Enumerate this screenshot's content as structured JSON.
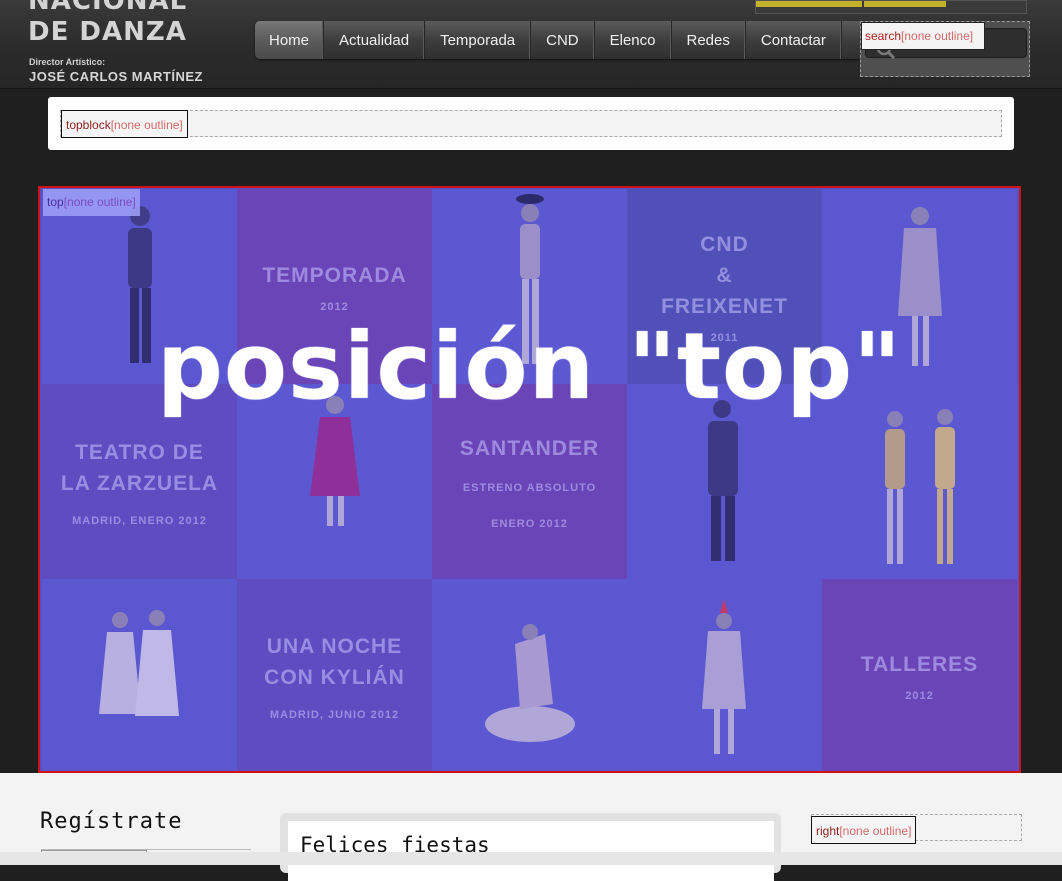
{
  "logo": {
    "line1": "NACIONAL",
    "line2": "DE DANZA",
    "director_label": "Director Artístico:",
    "director_name": "JOSÉ CARLOS MARTÍNEZ"
  },
  "nav": {
    "items": [
      {
        "label": "Home"
      },
      {
        "label": "Actualidad"
      },
      {
        "label": "Temporada"
      },
      {
        "label": "CND"
      },
      {
        "label": "Elenco"
      },
      {
        "label": "Redes"
      },
      {
        "label": "Contactar"
      }
    ]
  },
  "search": {
    "label": "search",
    "outline": "[none outline]",
    "icon": "search-icon"
  },
  "topblock": {
    "label": "topblock",
    "outline": "[none outline]"
  },
  "banner": {
    "label": "top",
    "outline": "[none outline]",
    "overlay_text": "posición \"top\"",
    "tiles": [
      {
        "type": "figure"
      },
      {
        "type": "text",
        "title": "TEMPORADA",
        "sub": "2012"
      },
      {
        "type": "figure"
      },
      {
        "type": "text",
        "title": "CND\n&\nFREIXENET",
        "sub": "2011"
      },
      {
        "type": "figure"
      },
      {
        "type": "text",
        "title": "TEATRO DE\nLA ZARZUELA",
        "sub": "MADRID, ENERO 2012"
      },
      {
        "type": "figure"
      },
      {
        "type": "text",
        "title": "SANTANDER",
        "sub": "ESTRENO ABSOLUTO",
        "sub2": "ENERO 2012"
      },
      {
        "type": "figure"
      },
      {
        "type": "figure"
      },
      {
        "type": "figure"
      },
      {
        "type": "text",
        "title": "UNA NOCHE\nCON KYLIÁN",
        "sub": "MADRID, JUNIO 2012"
      },
      {
        "type": "figure"
      },
      {
        "type": "figure"
      },
      {
        "type": "text",
        "title": "TALLERES",
        "sub": "2012"
      }
    ]
  },
  "bottom": {
    "register_title": "Regístrate",
    "news_title": "Felices fiestas",
    "right_label": "right",
    "right_outline": "[none outline]"
  },
  "colors": {
    "banner_overlay": "#5552c9",
    "banner_border": "#d01212",
    "nav_bg": "#3d3d3d",
    "logo_text": "#d4d4d4"
  }
}
